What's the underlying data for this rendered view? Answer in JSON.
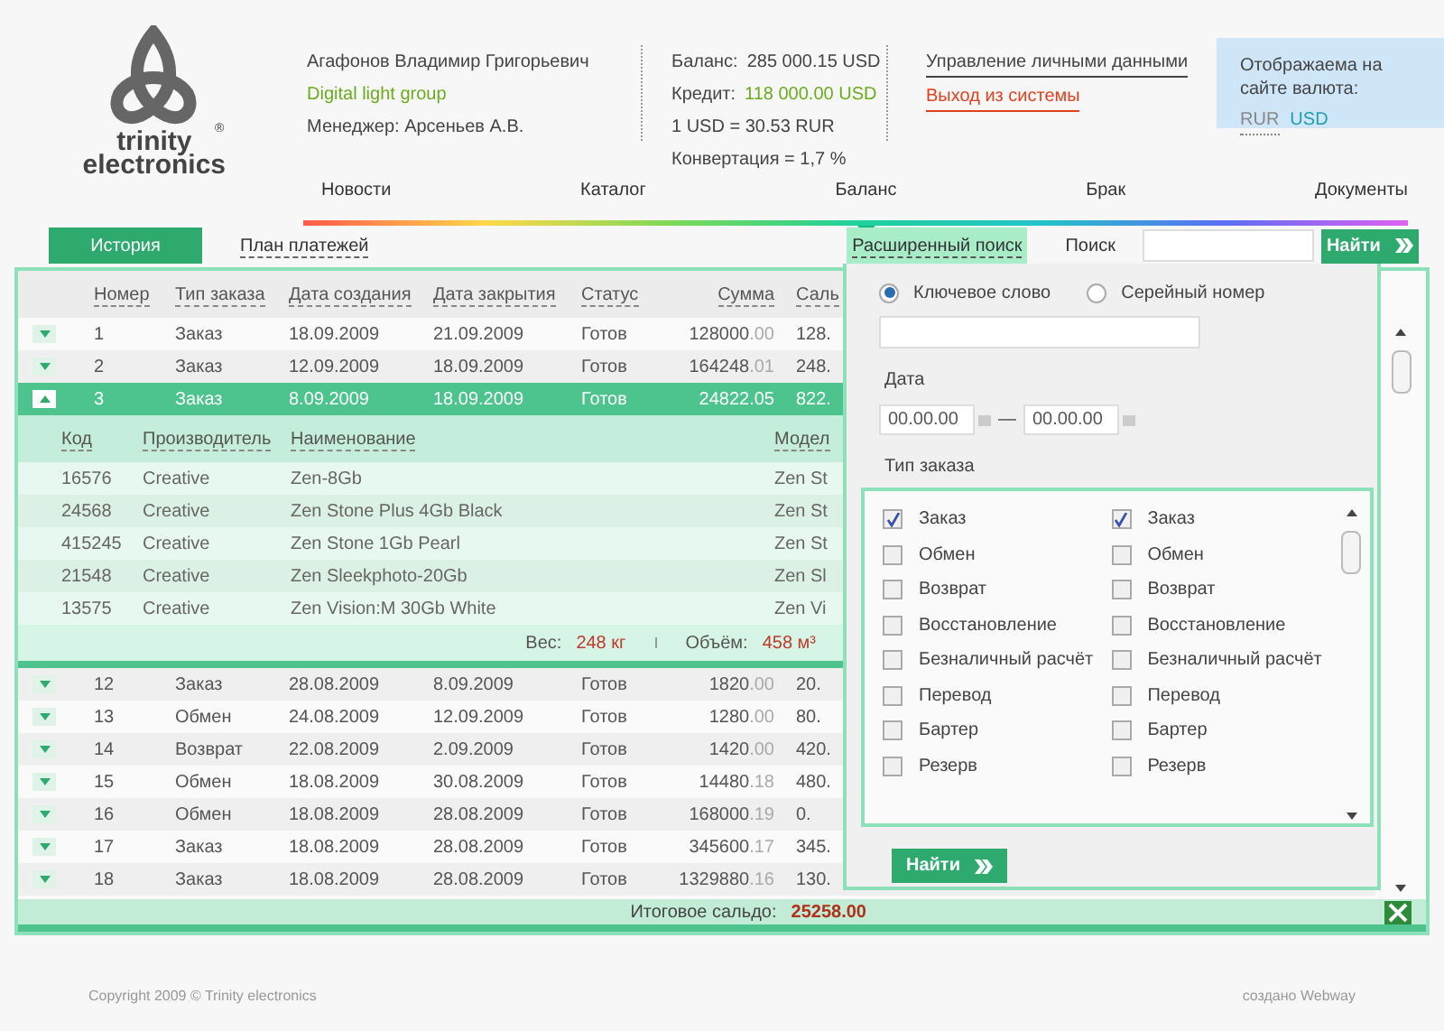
{
  "logo": {
    "line_1": "trinity",
    "line_2": "electronics",
    "mark": "®"
  },
  "user": {
    "name": "Агафонов Владимир Григорьевич",
    "company": "Digital light group",
    "manager": "Менеджер: Арсеньев А.В."
  },
  "account": [
    {
      "kind": "pair",
      "label": "Баланс:",
      "value": "285 000.15 USD",
      "highlight": false
    },
    {
      "kind": "pair",
      "label": "Кредит:",
      "value": "118 000.00 USD",
      "highlight": true
    },
    {
      "kind": "note",
      "label": "1 USD = 30.53 RUR"
    },
    {
      "kind": "note",
      "label": "Конвертация = 1,7 %"
    }
  ],
  "links": [
    {
      "kind": "profile",
      "label": "Управление личными данными"
    },
    {
      "kind": "logout",
      "label": "Выход из системы"
    }
  ],
  "currency": {
    "label": "Отображаема на сайте валюта:",
    "options": [
      {
        "label": "RUR",
        "selected": false
      },
      {
        "label": "USD",
        "selected": true
      }
    ]
  },
  "nav": [
    {
      "label": "Новости",
      "selected": false
    },
    {
      "label": "Каталог",
      "selected": false
    },
    {
      "label": "Баланс",
      "selected": true
    },
    {
      "label": "Брак",
      "selected": false
    },
    {
      "label": "Документы",
      "selected": false
    }
  ],
  "tabs": [
    {
      "label": "История",
      "selected": true
    },
    {
      "label": "План платежей",
      "selected": false
    }
  ],
  "advanced_search": {
    "label": "Расширенный поиск",
    "expanded": true
  },
  "search": {
    "label": "Поиск",
    "button": "Найти"
  },
  "table": {
    "columns": [
      "Номер",
      "Тип заказа",
      "Дата создания",
      "Дата закрытия",
      "Статус",
      "Сумма",
      "Саль"
    ],
    "rows": [
      {
        "number": "1",
        "type": "Заказ",
        "created": "18.09.2009",
        "closed": "21.09.2009",
        "status": "Готов",
        "amount": "128000",
        "cents": ".00",
        "saldo": "128.",
        "expanded": false
      },
      {
        "number": "2",
        "type": "Заказ",
        "created": "12.09.2009",
        "closed": "18.09.2009",
        "status": "Готов",
        "amount": "164248",
        "cents": ".01",
        "saldo": "248.",
        "expanded": false
      },
      {
        "number": "3",
        "type": "Заказ",
        "created": "8.09.2009",
        "closed": "18.09.2009",
        "status": "Готов",
        "amount": "24822",
        "cents": ".05",
        "saldo": "822.",
        "expanded": true,
        "details": {
          "columns": [
            "Код",
            "Производитель",
            "Наименование",
            "Модел"
          ],
          "rows": [
            [
              "16576",
              "Creative",
              "Zen-8Gb",
              "Zen St"
            ],
            [
              "24568",
              "Creative",
              "Zen Stone Plus 4Gb Black",
              "Zen St"
            ],
            [
              "415245",
              "Creative",
              "Zen Stone 1Gb Pearl",
              "Zen St"
            ],
            [
              "21548",
              "Creative",
              "Zen Sleekphoto-20Gb",
              "Zen Sl"
            ],
            [
              "13575",
              "Creative",
              "Zen Vision:M 30Gb White",
              "Zen Vi"
            ]
          ],
          "weight_label": "Вес:",
          "weight": "248 кг",
          "volume_label": "Объём:",
          "volume": "458 м³"
        }
      },
      {
        "number": "12",
        "type": "Заказ",
        "created": "28.08.2009",
        "closed": "8.09.2009",
        "status": "Готов",
        "amount": "1820",
        "cents": ".00",
        "saldo": "20.",
        "expanded": false
      },
      {
        "number": "13",
        "type": "Обмен",
        "created": "24.08.2009",
        "closed": "12.09.2009",
        "status": "Готов",
        "amount": "1280",
        "cents": ".00",
        "saldo": "80.",
        "expanded": false
      },
      {
        "number": "14",
        "type": "Возврат",
        "created": "22.08.2009",
        "closed": "2.09.2009",
        "status": "Готов",
        "amount": "1420",
        "cents": ".00",
        "saldo": "420.",
        "expanded": false
      },
      {
        "number": "15",
        "type": "Обмен",
        "created": "18.08.2009",
        "closed": "30.08.2009",
        "status": "Готов",
        "amount": "14480",
        "cents": ".18",
        "saldo": "480.",
        "expanded": false
      },
      {
        "number": "16",
        "type": "Обмен",
        "created": "18.08.2009",
        "closed": "28.08.2009",
        "status": "Готов",
        "amount": "168000",
        "cents": ".19",
        "saldo": "0.",
        "expanded": false
      },
      {
        "number": "17",
        "type": "Заказ",
        "created": "18.08.2009",
        "closed": "28.08.2009",
        "status": "Готов",
        "amount": "345600",
        "cents": ".17",
        "saldo": "345.",
        "expanded": false
      },
      {
        "number": "18",
        "type": "Заказ",
        "created": "18.08.2009",
        "closed": "28.08.2009",
        "status": "Готов",
        "amount": "1329880",
        "cents": ".16",
        "saldo": "130.",
        "expanded": false
      }
    ],
    "total_label": "Итоговое сальдо:",
    "total_value": "25258.00"
  },
  "popup": {
    "radios": [
      {
        "label": "Ключевое слово",
        "selected": true
      },
      {
        "label": "Серейный номер",
        "selected": false
      }
    ],
    "date_label": "Дата",
    "date_from": {
      "placeholder": "00.00.00"
    },
    "date_separator": "—",
    "date_to": {
      "placeholder": "00.00.00"
    },
    "order_type_label": "Тип заказа",
    "order_type_columns": [
      {
        "items": [
          {
            "label": "Заказ",
            "checked": true
          },
          {
            "label": "Обмен",
            "checked": false
          },
          {
            "label": "Возврат",
            "checked": false
          },
          {
            "label": "Восстановление",
            "checked": false
          },
          {
            "label": "Безналичный расчёт",
            "checked": false
          },
          {
            "label": "Перевод",
            "checked": false
          },
          {
            "label": "Бартер",
            "checked": false
          },
          {
            "label": "Резерв",
            "checked": false
          }
        ]
      },
      {
        "items": [
          {
            "label": "Заказ",
            "checked": true
          },
          {
            "label": "Обмен",
            "checked": false
          },
          {
            "label": "Возврат",
            "checked": false
          },
          {
            "label": "Восстановление",
            "checked": false
          },
          {
            "label": "Безналичный расчёт",
            "checked": false
          },
          {
            "label": "Перевод",
            "checked": false
          },
          {
            "label": "Бартер",
            "checked": false
          },
          {
            "label": "Резерв",
            "checked": false
          }
        ]
      }
    ],
    "button": "Найти"
  },
  "footer": {
    "copyright": "Copyright 2009 © Trinity electronics",
    "credit": "создано Webway"
  }
}
